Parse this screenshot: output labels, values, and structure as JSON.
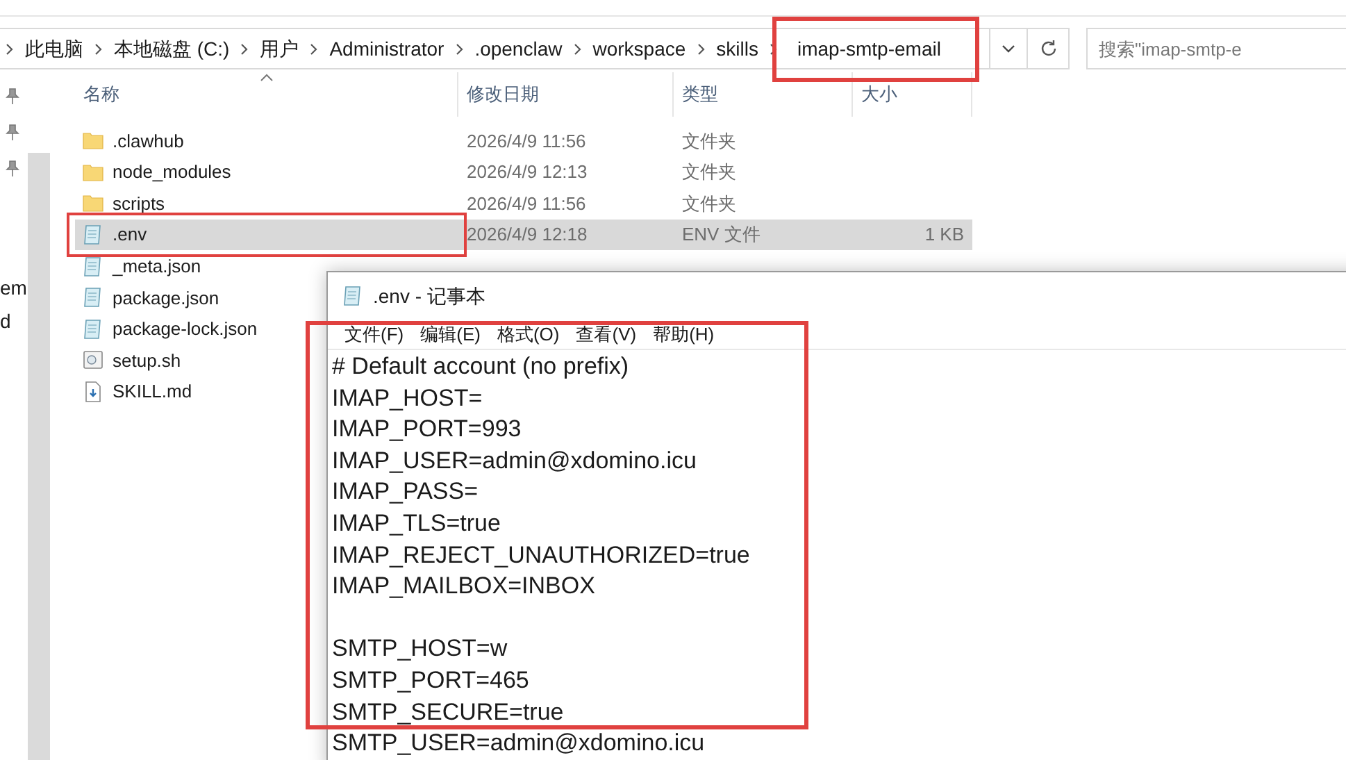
{
  "explorer": {
    "breadcrumbs": [
      {
        "label": "此电脑",
        "annotated": false
      },
      {
        "label": "本地磁盘 (C:)",
        "annotated": false
      },
      {
        "label": "用户",
        "annotated": false
      },
      {
        "label": "Administrator",
        "annotated": false
      },
      {
        "label": ".openclaw",
        "annotated": false
      },
      {
        "label": "workspace",
        "annotated": false
      },
      {
        "label": "skills",
        "annotated": false
      },
      {
        "label": "imap-smtp-email",
        "annotated": true
      }
    ],
    "search": {
      "placeholder": "搜索\"imap-smtp-e"
    },
    "nav_pane": {
      "labels": [
        "em",
        "d"
      ]
    },
    "columns": [
      "名称",
      "修改日期",
      "类型",
      "大小"
    ],
    "files": [
      {
        "name": ".clawhub",
        "modified": "2026/4/9 11:56",
        "type": "文件夹",
        "kind": "folder",
        "selected": false,
        "annotated": false
      },
      {
        "name": "node_modules",
        "modified": "2026/4/9 12:13",
        "type": "文件夹",
        "kind": "folder",
        "selected": false,
        "annotated": false
      },
      {
        "name": "scripts",
        "modified": "2026/4/9 11:56",
        "type": "文件夹",
        "kind": "folder",
        "selected": false,
        "annotated": false
      },
      {
        "name": ".env",
        "modified": "2026/4/9 12:18",
        "type": "ENV 文件",
        "size": "1 KB",
        "kind": "text",
        "selected": true,
        "annotated": true
      },
      {
        "name": "_meta.json",
        "kind": "text",
        "selected": false,
        "annotated": false
      },
      {
        "name": "package.json",
        "kind": "text",
        "selected": false,
        "annotated": false
      },
      {
        "name": "package-lock.json",
        "kind": "text",
        "selected": false,
        "annotated": false
      },
      {
        "name": "setup.sh",
        "kind": "script",
        "selected": false,
        "annotated": false
      },
      {
        "name": "SKILL.md",
        "kind": "markdown",
        "selected": false,
        "annotated": false
      }
    ]
  },
  "notepad": {
    "title": ".env - 记事本",
    "menu": [
      "文件(F)",
      "编辑(E)",
      "格式(O)",
      "查看(V)",
      "帮助(H)"
    ],
    "annotated": true,
    "sections": [
      [
        "# Default account (no prefix)",
        "IMAP_HOST=",
        "IMAP_PORT=993",
        "IMAP_USER=admin@xdomino.icu",
        "IMAP_PASS=",
        "IMAP_TLS=true",
        "IMAP_REJECT_UNAUTHORIZED=true",
        "IMAP_MAILBOX=INBOX"
      ],
      [
        "SMTP_HOST=w",
        "SMTP_PORT=465",
        "SMTP_SECURE=true",
        "SMTP_USER=admin@xdomino.icu"
      ]
    ]
  }
}
